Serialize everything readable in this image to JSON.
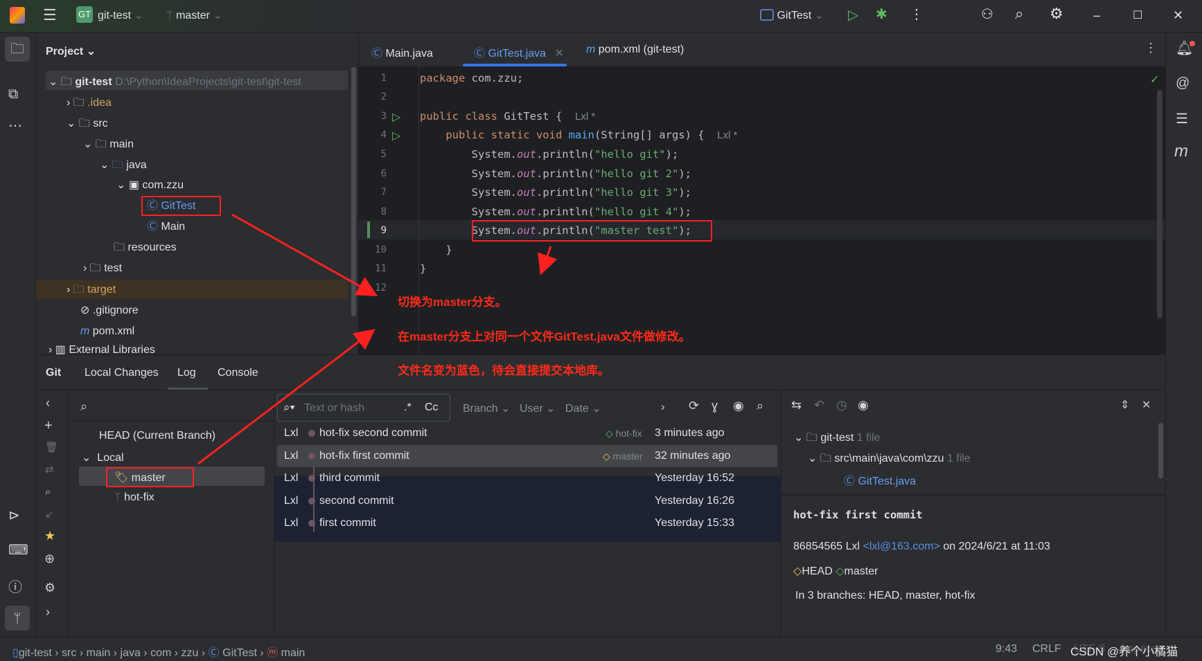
{
  "titlebar": {
    "project_badge": "GT",
    "project": "git-test",
    "branch": "master",
    "run_config": "GitTest"
  },
  "project_panel": {
    "title": "Project",
    "tree": [
      {
        "label": "git-test",
        "path": "D:\\Python\\IdeaProjects\\git-test\\git-test"
      },
      {
        "label": ".idea"
      },
      {
        "label": "src"
      },
      {
        "label": "main"
      },
      {
        "label": "java"
      },
      {
        "label": "com.zzu"
      },
      {
        "label": "GitTest"
      },
      {
        "label": "Main"
      },
      {
        "label": "resources"
      },
      {
        "label": "test"
      },
      {
        "label": "target"
      },
      {
        "label": ".gitignore"
      },
      {
        "label": "pom.xml"
      },
      {
        "label": "External Libraries"
      }
    ]
  },
  "editor": {
    "tabs": [
      {
        "label": "Main.java"
      },
      {
        "label": "GitTest.java"
      },
      {
        "label": "pom.xml (git-test)"
      }
    ],
    "line_numbers": [
      "1",
      "2",
      "3",
      "4",
      "5",
      "6",
      "7",
      "8",
      "9",
      "10",
      "11",
      "12"
    ],
    "author_hint": "Lxl *",
    "code": {
      "l1a": "package",
      "l1b": " com.zzu;",
      "l3a": "public class",
      "l3b": " GitTest {",
      "l4a": "    public static void",
      "l4b": " main",
      "l4c": "(String[] args) {",
      "sys": "        System.",
      "out": "out",
      "println": ".println(",
      "p5": "\"hello git\"",
      "p6": "\"hello git 2\"",
      "p7": "\"hello git 3\"",
      "p8": "\"hello git 4\"",
      "p9": "\"master test\"",
      "end": ");",
      "l10": "    }",
      "l11": "}"
    }
  },
  "annotations": [
    "切换为master分支。",
    "在master分支上对同一个文件GitTest.java文件做修改。",
    "文件名变为蓝色，待会直接提交本地库。"
  ],
  "git": {
    "tabs": [
      "Git",
      "Local Changes",
      "Log",
      "Console"
    ],
    "branches": {
      "head": "HEAD (Current Branch)",
      "local": "Local",
      "items": [
        "master",
        "hot-fix"
      ]
    },
    "log": {
      "search_placeholder": "Text or hash",
      "regex": ".*",
      "case": "Cc",
      "filters": [
        "Branch",
        "User",
        "Date"
      ],
      "commits": [
        {
          "author": "Lxl",
          "message": "hot-fix second commit",
          "ref": "hot-fix",
          "date": "3 minutes ago"
        },
        {
          "author": "Lxl",
          "message": "hot-fix first commit",
          "ref": "master",
          "date": "32 minutes ago"
        },
        {
          "author": "Lxl",
          "message": "third commit",
          "ref": "",
          "date": "Yesterday 16:52"
        },
        {
          "author": "Lxl",
          "message": "second commit",
          "ref": "",
          "date": "Yesterday 16:26"
        },
        {
          "author": "Lxl",
          "message": "first commit",
          "ref": "",
          "date": "Yesterday 15:33"
        }
      ]
    },
    "details": {
      "root": "git-test",
      "root_count": "1 file",
      "dir": "src\\main\\java\\com\\zzu",
      "dir_count": "1 file",
      "file": "GitTest.java",
      "title": "hot-fix first commit",
      "hash_author": "86854565 Lxl",
      "email": "<lxl@163.com>",
      "when": "on 2024/6/21 at 11:03",
      "refs": [
        "HEAD",
        "master"
      ],
      "branches": "In 3 branches: HEAD, master, hot-fix"
    }
  },
  "statusbar": {
    "crumbs": [
      "git-test",
      "src",
      "main",
      "java",
      "com",
      "zzu",
      "GitTest",
      "main"
    ],
    "position": "9:43",
    "line_sep": "CRLF",
    "encoding": "UTF-8",
    "indent": "4 spaces"
  },
  "watermark": "CSDN @养个小橘猫"
}
